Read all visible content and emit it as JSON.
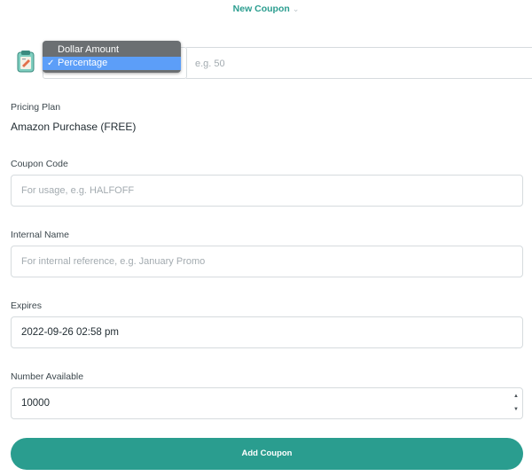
{
  "header": {
    "title": "New Coupon"
  },
  "discount": {
    "options": [
      "Dollar Amount",
      "Percentage"
    ],
    "selected_check": "✓",
    "amount_placeholder": "e.g. 50"
  },
  "pricing_plan": {
    "label": "Pricing Plan",
    "value": "Amazon Purchase (FREE)"
  },
  "coupon_code": {
    "label": "Coupon Code",
    "placeholder": "For usage, e.g. HALFOFF"
  },
  "internal_name": {
    "label": "Internal Name",
    "placeholder": "For internal reference, e.g. January Promo"
  },
  "expires": {
    "label": "Expires",
    "value": "2022-09-26 02:58 pm"
  },
  "number_available": {
    "label": "Number Available",
    "value": "10000"
  },
  "submit": {
    "label": "Add Coupon"
  },
  "colors": {
    "accent": "#2a9d8f",
    "dropdown_bg": "#6b6f72",
    "dropdown_selected": "#5c9ef8"
  }
}
